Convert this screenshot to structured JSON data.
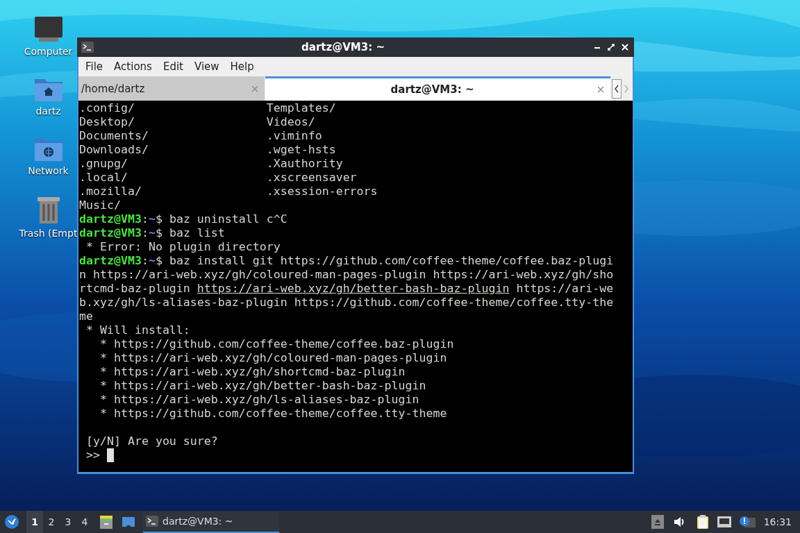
{
  "desktop": {
    "icons": [
      {
        "kind": "monitor",
        "label": "Computer"
      },
      {
        "kind": "home",
        "label": "dartz"
      },
      {
        "kind": "network",
        "label": "Network"
      },
      {
        "kind": "trash",
        "label": "Trash (Empt"
      }
    ]
  },
  "window": {
    "title": "dartz@VM3: ~",
    "menu": [
      "File",
      "Actions",
      "Edit",
      "View",
      "Help"
    ],
    "tabs": [
      {
        "label": "/home/dartz",
        "selected": false
      },
      {
        "label": "dartz@VM3: ~",
        "selected": true
      }
    ],
    "terminal": {
      "lines": [
        {
          "kind": "columns",
          "cells": [
            ".config/",
            "Templates/"
          ]
        },
        {
          "kind": "columns",
          "cells": [
            "Desktop/",
            "Videos/"
          ]
        },
        {
          "kind": "columns",
          "cells": [
            "Documents/",
            ".viminfo"
          ]
        },
        {
          "kind": "columns",
          "cells": [
            "Downloads/",
            ".wget-hsts"
          ]
        },
        {
          "kind": "columns",
          "cells": [
            ".gnupg/",
            ".Xauthority"
          ]
        },
        {
          "kind": "columns",
          "cells": [
            ".local/",
            ".xscreensaver"
          ]
        },
        {
          "kind": "columns",
          "cells": [
            ".mozilla/",
            ".xsession-errors"
          ]
        },
        {
          "kind": "columns",
          "cells": [
            "Music/"
          ]
        },
        {
          "kind": "text",
          "segments": [
            {
              "kind": "user",
              "text": "dartz@VM3"
            },
            {
              "kind": "plain",
              "text": ":"
            },
            {
              "kind": "path",
              "text": "~"
            },
            {
              "kind": "plain",
              "text": "$ baz uninstall c^C"
            }
          ]
        },
        {
          "kind": "text",
          "segments": [
            {
              "kind": "user",
              "text": "dartz@VM3"
            },
            {
              "kind": "plain",
              "text": ":"
            },
            {
              "kind": "path",
              "text": "~"
            },
            {
              "kind": "plain",
              "text": "$ baz list"
            }
          ]
        },
        {
          "kind": "text",
          "segments": [
            {
              "kind": "plain",
              "text": " * Error: No plugin directory"
            }
          ]
        },
        {
          "kind": "text",
          "segments": [
            {
              "kind": "user",
              "text": "dartz@VM3"
            },
            {
              "kind": "plain",
              "text": ":"
            },
            {
              "kind": "path",
              "text": "~"
            },
            {
              "kind": "plain",
              "text": "$ baz install git https://github.com/coffee-theme/coffee.baz-plugi"
            }
          ]
        },
        {
          "kind": "text",
          "segments": [
            {
              "kind": "plain",
              "text": "n https://ari-web.xyz/gh/coloured-man-pages-plugin https://ari-web.xyz/gh/sho"
            }
          ]
        },
        {
          "kind": "text",
          "segments": [
            {
              "kind": "plain",
              "text": "rtcmd-baz-plugin "
            },
            {
              "kind": "link",
              "text": "https://ari-web.xyz/gh/better-bash-baz-plugin"
            },
            {
              "kind": "plain",
              "text": " https://ari-we"
            }
          ]
        },
        {
          "kind": "text",
          "segments": [
            {
              "kind": "plain",
              "text": "b.xyz/gh/ls-aliases-baz-plugin https://github.com/coffee-theme/coffee.tty-the"
            }
          ]
        },
        {
          "kind": "text",
          "segments": [
            {
              "kind": "plain",
              "text": "me"
            }
          ]
        },
        {
          "kind": "text",
          "segments": [
            {
              "kind": "plain",
              "text": " * Will install:"
            }
          ]
        },
        {
          "kind": "text",
          "segments": [
            {
              "kind": "plain",
              "text": "   * https://github.com/coffee-theme/coffee.baz-plugin"
            }
          ]
        },
        {
          "kind": "text",
          "segments": [
            {
              "kind": "plain",
              "text": "   * https://ari-web.xyz/gh/coloured-man-pages-plugin"
            }
          ]
        },
        {
          "kind": "text",
          "segments": [
            {
              "kind": "plain",
              "text": "   * https://ari-web.xyz/gh/shortcmd-baz-plugin"
            }
          ]
        },
        {
          "kind": "text",
          "segments": [
            {
              "kind": "plain",
              "text": "   * https://ari-web.xyz/gh/better-bash-baz-plugin"
            }
          ]
        },
        {
          "kind": "text",
          "segments": [
            {
              "kind": "plain",
              "text": "   * https://ari-web.xyz/gh/ls-aliases-baz-plugin"
            }
          ]
        },
        {
          "kind": "text",
          "segments": [
            {
              "kind": "plain",
              "text": "   * https://github.com/coffee-theme/coffee.tty-theme"
            }
          ]
        },
        {
          "kind": "blank"
        },
        {
          "kind": "text",
          "segments": [
            {
              "kind": "plain",
              "text": " [y/N] Are you sure?"
            }
          ]
        },
        {
          "kind": "input",
          "segments": [
            {
              "kind": "plain",
              "text": " >> "
            }
          ]
        }
      ]
    }
  },
  "taskbar": {
    "workspaces": [
      {
        "label": "1",
        "selected": true
      },
      {
        "label": "2",
        "selected": false
      },
      {
        "label": "3",
        "selected": false
      },
      {
        "label": "4",
        "selected": false
      }
    ],
    "tasks": [
      {
        "label": "dartz@VM3: ~",
        "selected": true
      }
    ],
    "clock": "16:31"
  }
}
